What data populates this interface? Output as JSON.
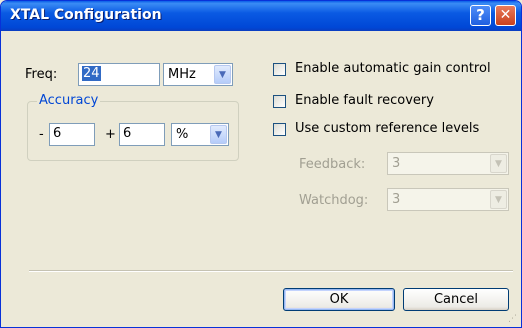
{
  "window": {
    "title": "XTAL Configuration",
    "help_label": "?",
    "close_label": "✕"
  },
  "freq": {
    "label": "Freq:",
    "value": "24",
    "unit": "MHz"
  },
  "accuracy": {
    "title": "Accuracy",
    "minus_sign": "-",
    "minus_value": "6",
    "plus_sign": "+",
    "plus_value": "6",
    "unit": "%"
  },
  "options": {
    "agc": {
      "label": "Enable automatic gain control",
      "checked": false
    },
    "fault": {
      "label": "Enable fault recovery",
      "checked": false
    },
    "custom_ref": {
      "label": "Use custom reference levels",
      "checked": false
    }
  },
  "reference": {
    "feedback": {
      "label": "Feedback:",
      "value": "3"
    },
    "watchdog": {
      "label": "Watchdog:",
      "value": "3"
    }
  },
  "buttons": {
    "ok": "OK",
    "cancel": "Cancel"
  },
  "colors": {
    "titlebar": "#0a5ae3",
    "face": "#ece9d8",
    "group_title": "#0046d5"
  }
}
